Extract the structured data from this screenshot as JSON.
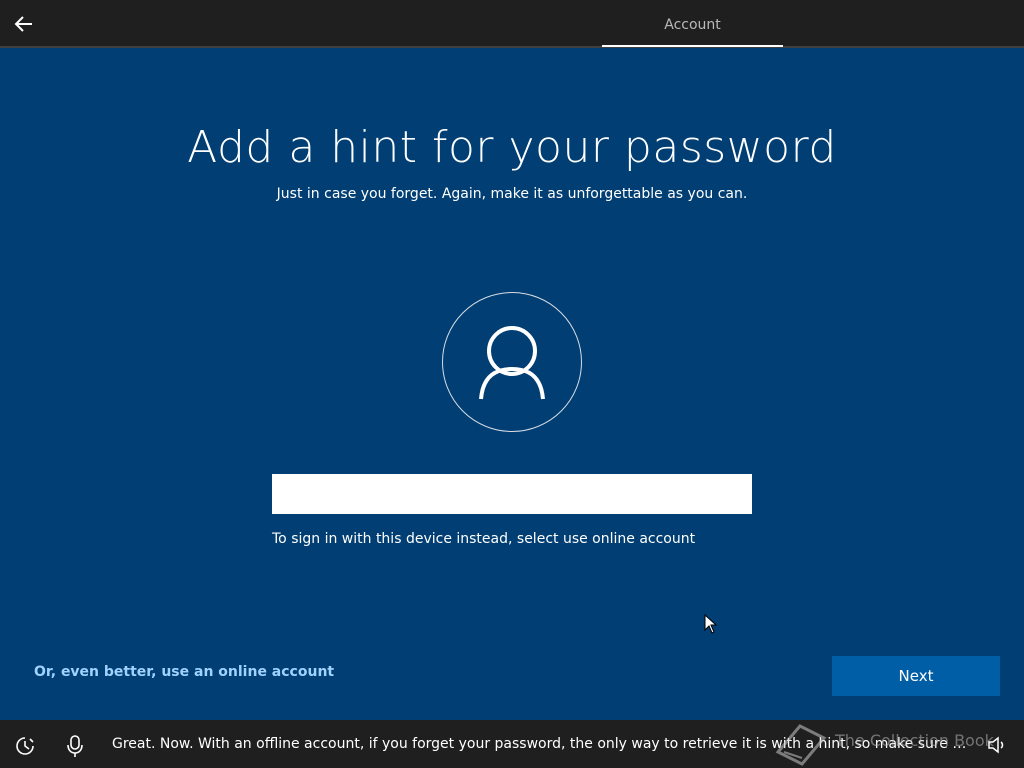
{
  "header": {
    "back_icon": "arrow-left-icon",
    "tab_label": "Account"
  },
  "main": {
    "title": "Add a hint for your password",
    "subtitle": "Just in case you forget. Again, make it as unforgettable as you can.",
    "avatar_icon": "user-icon",
    "hint_input": {
      "value": "",
      "placeholder": ""
    },
    "signin_note": "To sign in with this device instead, select use online account"
  },
  "footer_actions": {
    "online_account_link": "Or, even better, use an online account",
    "next_button": "Next"
  },
  "bottom_bar": {
    "ease_of_access_icon": "ease-of-access-icon",
    "microphone_icon": "microphone-icon",
    "cortana_message": "Great. Now. With an offline account, if you forget your password, the only way to retrieve it is with a hint, so make sure it's mem...",
    "speaker_icon": "speaker-icon"
  },
  "watermark": {
    "text": "The Collection Book"
  },
  "colors": {
    "background": "#003e73",
    "top_bar": "#1f1f1f",
    "button": "#005ea6",
    "link": "#9fd2ff"
  }
}
